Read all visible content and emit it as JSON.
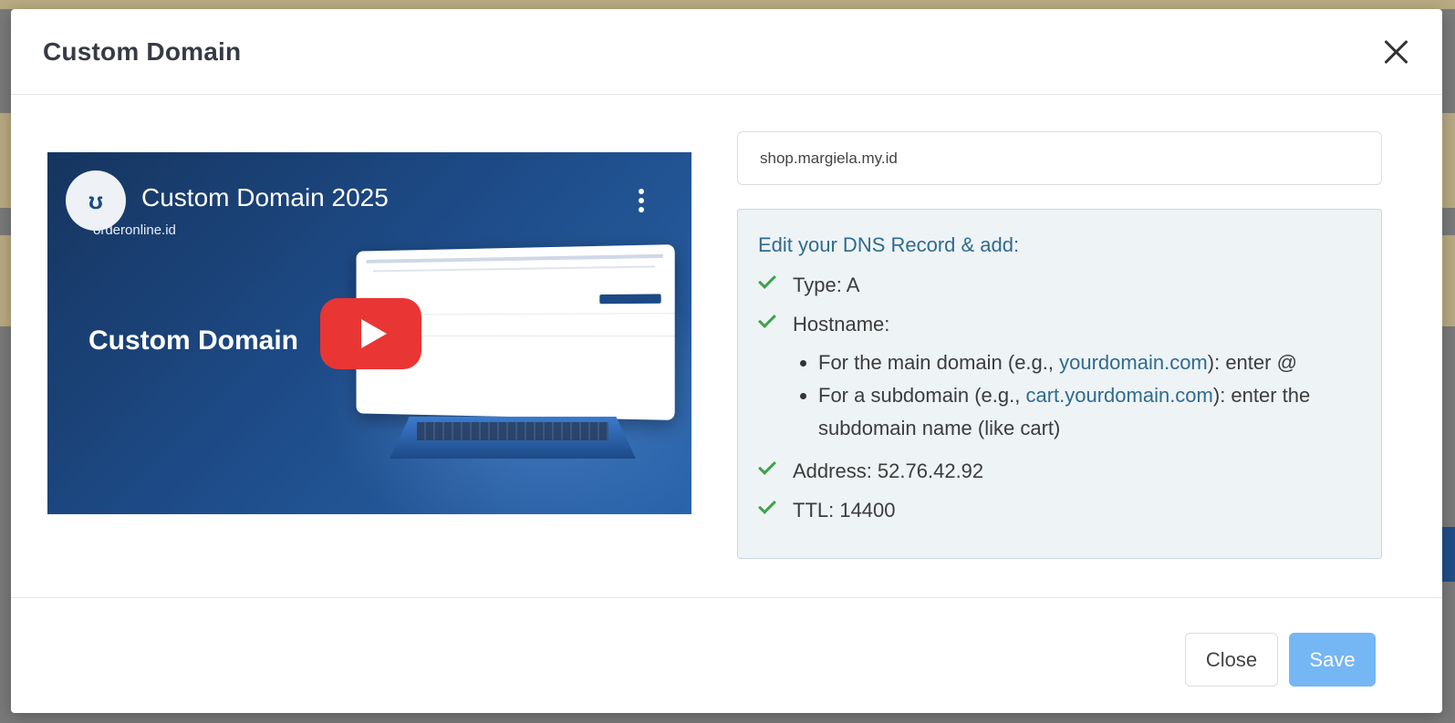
{
  "modal": {
    "title": "Custom Domain",
    "close_icon": "close-icon"
  },
  "video": {
    "title": "Custom Domain 2025",
    "channel": "orderonline.id",
    "overlay_text": "Custom Domain",
    "play_icon": "play-icon",
    "menu_icon": "more-vertical-icon"
  },
  "domain_input": {
    "value": "shop.margiela.my.id"
  },
  "dns": {
    "heading": "Edit your DNS Record & add:",
    "type": "Type: A",
    "hostname": "Hostname:",
    "sub": [
      {
        "prefix": "For the main domain (e.g., ",
        "link": "yourdomain.com",
        "suffix": "): enter @"
      },
      {
        "prefix": "For a subdomain (e.g., ",
        "link": "cart.yourdomain.com",
        "suffix": "): enter the subdomain name (like cart)"
      }
    ],
    "address": "Address: 52.76.42.92",
    "ttl": "TTL: 14400",
    "check_color": "#3ea14a"
  },
  "footer": {
    "close_label": "Close",
    "save_label": "Save"
  },
  "colors": {
    "save_bg": "#75b6f5",
    "video_bg": "#1d4a86",
    "play_red": "#ea3535",
    "link": "#2f6b8e"
  }
}
